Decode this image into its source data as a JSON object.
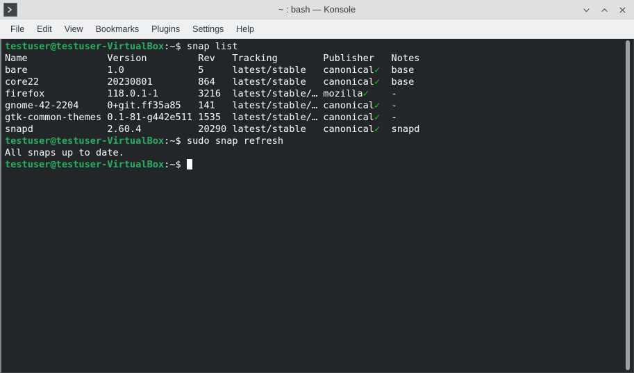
{
  "window": {
    "title": "~ : bash — Konsole",
    "icon": "konsole-prompt-icon",
    "controls": [
      {
        "name": "minimize-button",
        "glyph": "chevron-down"
      },
      {
        "name": "maximize-button",
        "glyph": "chevron-up"
      },
      {
        "name": "close-button",
        "glyph": "cross"
      }
    ]
  },
  "menubar": {
    "items": [
      {
        "label": "File"
      },
      {
        "label": "Edit"
      },
      {
        "label": "View"
      },
      {
        "label": "Bookmarks"
      },
      {
        "label": "Plugins"
      },
      {
        "label": "Settings"
      },
      {
        "label": "Help"
      }
    ]
  },
  "terminal": {
    "prompt_user": "testuser@testuser-VirtualBox",
    "prompt_path": ":~$",
    "colors": {
      "background": "#232629",
      "foreground": "#fcfcfc",
      "prompt": "#27ae60",
      "check": "#11d116"
    },
    "commands": {
      "first": "snap list",
      "second": "sudo snap refresh"
    },
    "output_message": "All snaps up to date.",
    "table": {
      "headers": [
        "Name",
        "Version",
        "Rev",
        "Tracking",
        "Publisher",
        "Notes"
      ],
      "rows": [
        {
          "name": "bare",
          "version": "1.0",
          "rev": "5",
          "tracking": "latest/stable",
          "publisher": "canonical",
          "verified": "✓",
          "notes": "base"
        },
        {
          "name": "core22",
          "version": "20230801",
          "rev": "864",
          "tracking": "latest/stable",
          "publisher": "canonical",
          "verified": "✓",
          "notes": "base"
        },
        {
          "name": "firefox",
          "version": "118.0.1-1",
          "rev": "3216",
          "tracking": "latest/stable/…",
          "publisher": "mozilla",
          "verified": "✓",
          "notes": "-"
        },
        {
          "name": "gnome-42-2204",
          "version": "0+git.ff35a85",
          "rev": "141",
          "tracking": "latest/stable/…",
          "publisher": "canonical",
          "verified": "✓",
          "notes": "-"
        },
        {
          "name": "gtk-common-themes",
          "version": "0.1-81-g442e511",
          "rev": "1535",
          "tracking": "latest/stable/…",
          "publisher": "canonical",
          "verified": "✓",
          "notes": "-"
        },
        {
          "name": "snapd",
          "version": "2.60.4",
          "rev": "20290",
          "tracking": "latest/stable",
          "publisher": "canonical",
          "verified": "✓",
          "notes": "snapd"
        }
      ],
      "columns": {
        "name": 18,
        "version": 16,
        "rev": 6,
        "tracking": 16,
        "publisher": 12
      }
    }
  }
}
